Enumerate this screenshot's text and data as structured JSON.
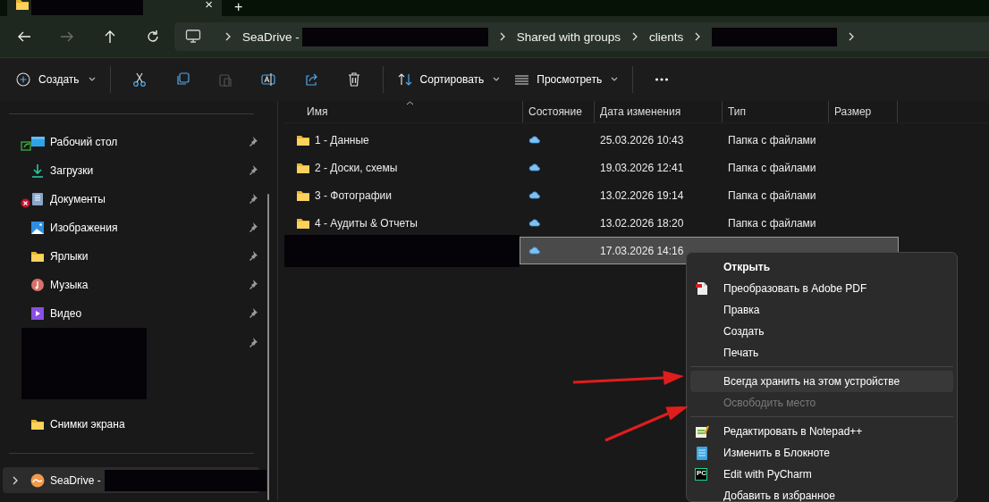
{
  "tab": {
    "redacted": true,
    "close": "×"
  },
  "new_tab": "+",
  "nav": [
    {
      "kind": "back",
      "disabled": false
    },
    {
      "kind": "forward",
      "disabled": true
    },
    {
      "kind": "up",
      "disabled": false
    },
    {
      "kind": "refresh",
      "disabled": false
    }
  ],
  "address_bar": {
    "segments": [
      {
        "label": "SeaDrive -",
        "redacted": true
      },
      {
        "label": "Shared with groups"
      },
      {
        "label": "clients"
      },
      {
        "redacted": true
      }
    ]
  },
  "toolbar": {
    "items": [
      {
        "kind": "create",
        "label": "Создать",
        "dropdown": true
      },
      {
        "kind": "separator"
      },
      {
        "kind": "cut",
        "disabled": false
      },
      {
        "kind": "copy",
        "disabled": false
      },
      {
        "kind": "paste",
        "disabled": true
      },
      {
        "kind": "rename",
        "disabled": false
      },
      {
        "kind": "share",
        "disabled": false
      },
      {
        "kind": "delete",
        "disabled": false
      },
      {
        "kind": "separator"
      },
      {
        "kind": "sort",
        "label": "Сортировать",
        "dropdown": true
      },
      {
        "kind": "view",
        "label": "Просмотреть",
        "dropdown": true
      },
      {
        "kind": "separator"
      },
      {
        "kind": "more",
        "disabled": false
      }
    ]
  },
  "sidebar": {
    "items": [
      {
        "kind": "desktop",
        "label": "Рабочий стол",
        "pinned": true,
        "shared": true,
        "error": false
      },
      {
        "kind": "downloads",
        "label": "Загрузки",
        "pinned": true,
        "shared": false,
        "error": false
      },
      {
        "kind": "documents",
        "label": "Документы",
        "pinned": true,
        "shared": false,
        "error": true
      },
      {
        "kind": "pictures",
        "label": "Изображения",
        "pinned": true,
        "shared": false,
        "error": false
      },
      {
        "kind": "folder",
        "label": "Ярлыки",
        "pinned": true,
        "shared": false,
        "error": false
      },
      {
        "kind": "music",
        "label": "Музыка",
        "pinned": true,
        "shared": false,
        "error": false
      },
      {
        "kind": "video",
        "label": "Видео",
        "pinned": true,
        "shared": false,
        "error": false
      },
      {
        "kind": "redacted",
        "pinned": true,
        "shared": false,
        "error": false
      },
      {
        "kind": "folder",
        "label": "Снимки экрана",
        "pinned": false,
        "shared": false,
        "error": false
      }
    ],
    "drive": {
      "label": "SeaDrive -",
      "redacted": true,
      "expanded": false,
      "selected": true
    }
  },
  "table": {
    "columns": [
      {
        "label": "Имя",
        "sorted": true
      },
      {
        "label": "Состояние",
        "sorted": false
      },
      {
        "label": "Дата изменения",
        "sorted": false
      },
      {
        "label": "Тип",
        "sorted": false
      },
      {
        "label": "Размер",
        "sorted": false
      }
    ],
    "rows": [
      {
        "name": "1 - Данные",
        "kind": "folder",
        "online_only": true,
        "date": "25.03.2026 10:43",
        "type": "Папка с файлами",
        "selected": false
      },
      {
        "name": "2 - Доски, схемы",
        "kind": "folder",
        "online_only": true,
        "date": "19.03.2026 12:41",
        "type": "Папка с файлами",
        "selected": false
      },
      {
        "name": "3 - Фотографии",
        "kind": "folder",
        "online_only": true,
        "date": "13.02.2026 19:14",
        "type": "Папка с файлами",
        "selected": false
      },
      {
        "name": "4 - Аудиты & Отчеты",
        "kind": "folder",
        "online_only": true,
        "date": "13.02.2026 18:20",
        "type": "Папка с файлами",
        "selected": false
      },
      {
        "kind": "redacted",
        "online_only": true,
        "date": "17.03.2026 14:16",
        "selected": true
      }
    ]
  },
  "context_menu": {
    "items": [
      {
        "kind": "plain",
        "label": "Открыть",
        "bold": true,
        "highlighted": false,
        "disabled": false
      },
      {
        "kind": "pdf",
        "label": "Преобразовать в Adobe PDF",
        "bold": false,
        "highlighted": false,
        "disabled": false
      },
      {
        "kind": "plain",
        "label": "Правка",
        "bold": false,
        "highlighted": false,
        "disabled": false
      },
      {
        "kind": "plain",
        "label": "Создать",
        "bold": false,
        "highlighted": false,
        "disabled": false
      },
      {
        "kind": "plain",
        "label": "Печать",
        "bold": false,
        "highlighted": false,
        "disabled": false
      },
      {
        "kind": "separator"
      },
      {
        "kind": "plain",
        "label": "Всегда хранить на этом устройстве",
        "bold": false,
        "highlighted": true,
        "disabled": false
      },
      {
        "kind": "plain",
        "label": "Освободить место",
        "bold": false,
        "highlighted": false,
        "disabled": true
      },
      {
        "kind": "separator"
      },
      {
        "kind": "notepadpp",
        "label": "Редактировать в Notepad++",
        "bold": false,
        "highlighted": false,
        "disabled": false
      },
      {
        "kind": "notepad",
        "label": "Изменить в Блокноте",
        "bold": false,
        "highlighted": false,
        "disabled": false
      },
      {
        "kind": "pycharm",
        "label": "Edit with PyCharm",
        "icon_text": "PC",
        "bold": false,
        "highlighted": false,
        "disabled": false
      },
      {
        "kind": "plain",
        "label": "Добавить в избранное",
        "bold": false,
        "highlighted": false,
        "disabled": false
      }
    ]
  },
  "annotations": [
    {
      "kind": "arrow"
    },
    {
      "kind": "arrow"
    }
  ]
}
